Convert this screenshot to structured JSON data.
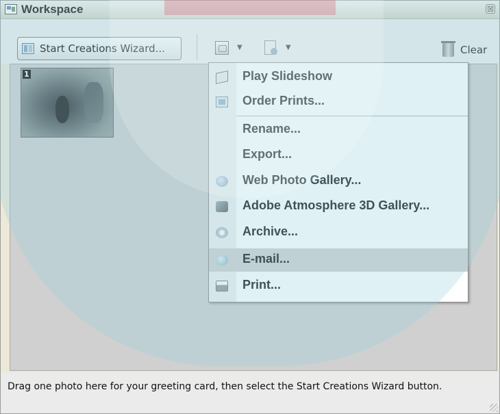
{
  "window": {
    "title": "Workspace",
    "close_glyph": "☒"
  },
  "toolbar": {
    "wizard_label": "Start Creations Wizard...",
    "share_icon": "share-icon",
    "create_icon": "create-icon",
    "dropdown_glyph": "▼",
    "clear_label": "Clear"
  },
  "photos": [
    {
      "number": "1",
      "description": "photo-thumbnail"
    }
  ],
  "menu": {
    "items": [
      {
        "label": "Play Slideshow",
        "icon": "slideshow-icon",
        "highlighted": false
      },
      {
        "label": "Order Prints...",
        "icon": "order-prints-icon",
        "highlighted": false
      },
      {
        "label": "Rename...",
        "icon": "",
        "highlighted": false
      },
      {
        "label": "Export...",
        "icon": "",
        "highlighted": false
      },
      {
        "label": "Web Photo Gallery...",
        "icon": "web-gallery-icon",
        "highlighted": false
      },
      {
        "label": "Adobe Atmosphere 3D Gallery...",
        "icon": "3d-gallery-icon",
        "highlighted": false
      },
      {
        "label": "Archive...",
        "icon": "archive-disc-icon",
        "highlighted": false
      },
      {
        "label": "E-mail...",
        "icon": "email-icon",
        "highlighted": true
      },
      {
        "label": "Print...",
        "icon": "printer-icon",
        "highlighted": false
      }
    ]
  },
  "status": {
    "text": "Drag one photo here for your greeting card, then select the Start Creations Wizard button."
  }
}
